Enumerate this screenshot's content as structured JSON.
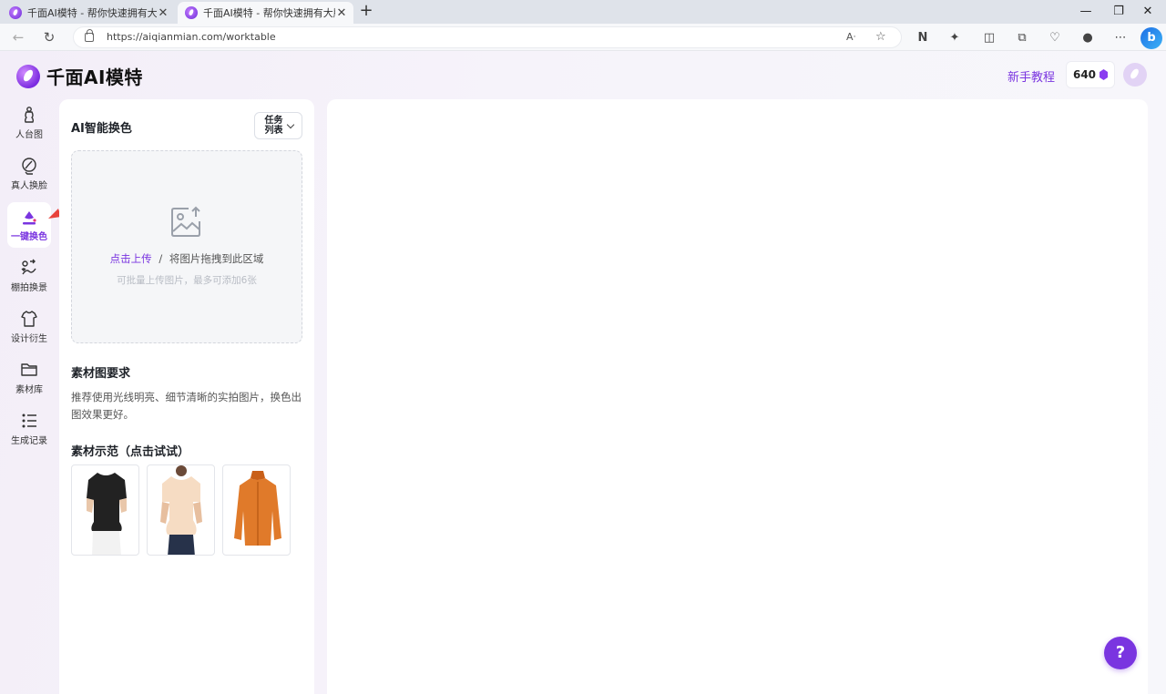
{
  "browser": {
    "tabs": [
      {
        "title": "千面AI模特 - 帮你快速拥有大牌同"
      },
      {
        "title": "千面AI模特 - 帮你快速拥有大牌同"
      }
    ],
    "new_tab": "+",
    "url": "https://aiqianmian.com/worktable",
    "window_controls": {
      "minimize": "—",
      "maximize": "❐",
      "close": "✕"
    }
  },
  "app": {
    "brand": "千面AI模特",
    "tutorial": "新手教程",
    "credits": "640",
    "accent": "#7a35e0"
  },
  "sidenav": [
    {
      "label": "人台图",
      "icon": "mannequin-icon"
    },
    {
      "label": "真人换脸",
      "icon": "face-swap-icon"
    },
    {
      "label": "一键换色",
      "icon": "paint-bucket-icon",
      "active": true
    },
    {
      "label": "棚拍换景",
      "icon": "scene-swap-icon"
    },
    {
      "label": "设计衍生",
      "icon": "shirt-icon"
    },
    {
      "label": "素材库",
      "icon": "folder-icon"
    },
    {
      "label": "生成记录",
      "icon": "list-icon"
    }
  ],
  "panel": {
    "title": "AI智能换色",
    "task_button": "任务列表",
    "upload": {
      "link": "点击上传",
      "separator": "/",
      "text": "将图片拖拽到此区域",
      "hint": "可批量上传图片，最多可添加6张"
    },
    "requirements_title": "素材图要求",
    "requirements_text": "推荐使用光线明亮、细节清晰的实拍图片，换色出图效果更好。",
    "examples_title": "素材示范（点击试试）"
  },
  "help": "?"
}
